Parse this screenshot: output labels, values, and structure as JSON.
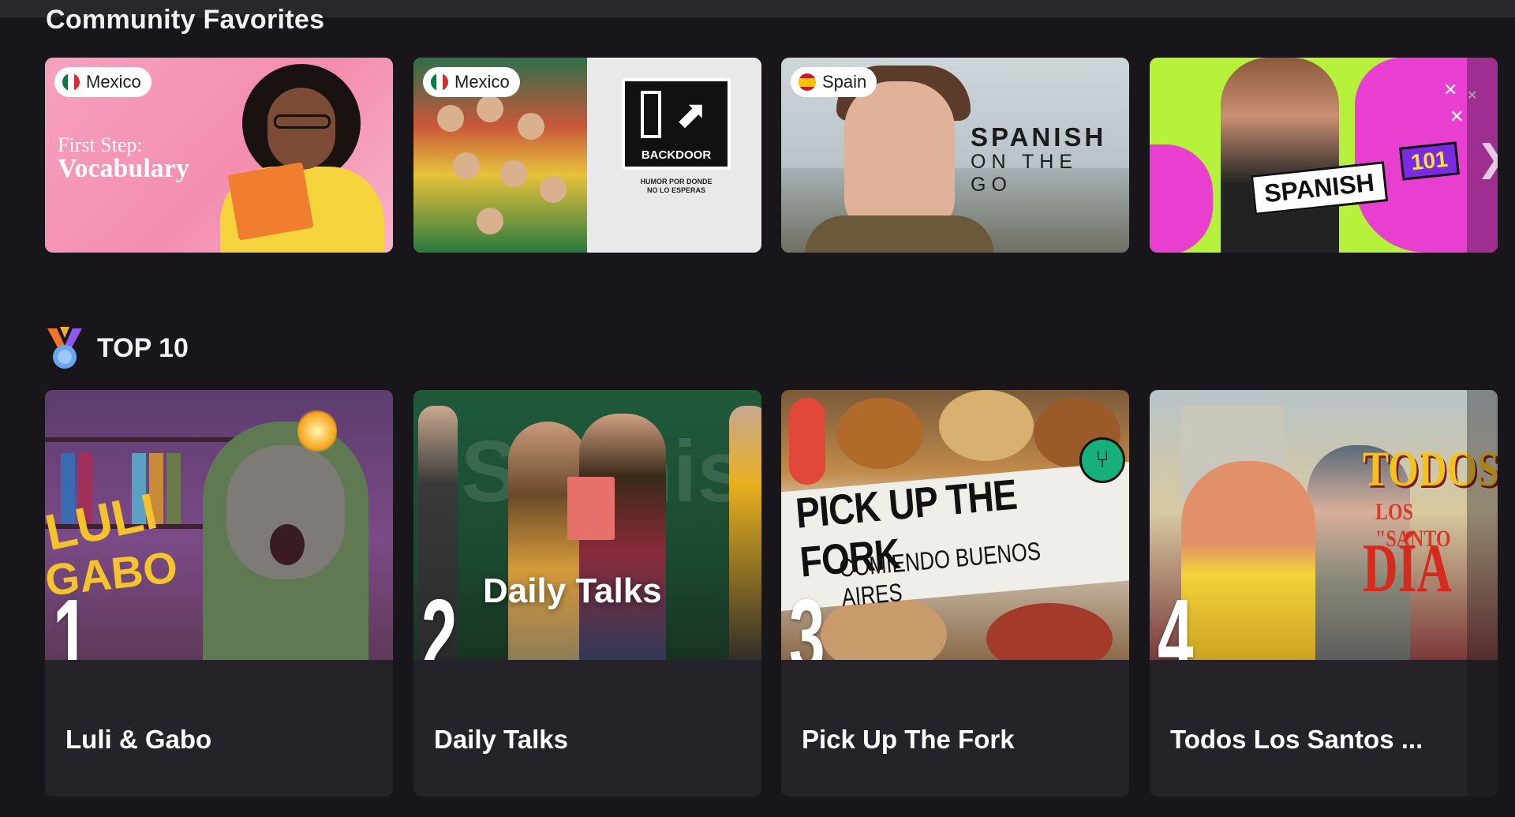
{
  "community_favorites": {
    "title": "Community Favorites",
    "cards": [
      {
        "country": "Mexico",
        "flag": "mexico-flag",
        "art_text": [
          "First Step:",
          "Vocabulary"
        ]
      },
      {
        "country": "Mexico",
        "flag": "mexico-flag",
        "art_text": [
          "BACKDOOR",
          "HUMOR POR DONDE",
          "NO LO ESPERAS"
        ]
      },
      {
        "country": "Spain",
        "flag": "spain-flag",
        "art_text": [
          "SPANISH",
          "ON THE GO"
        ]
      },
      {
        "country": "",
        "flag": "",
        "art_text": [
          "SPANISH",
          "101"
        ]
      }
    ],
    "next_icon": "chevron-right-icon"
  },
  "top10": {
    "title": "TOP 10",
    "icon": "medal-icon",
    "items": [
      {
        "rank": "1",
        "name": "Luli & Gabo",
        "art_text": [
          "LULI",
          "GABO"
        ]
      },
      {
        "rank": "2",
        "name": "Daily Talks",
        "art_text": [
          "Spanish",
          "Daily Talks"
        ]
      },
      {
        "rank": "3",
        "name": "Pick Up The Fork",
        "art_text": [
          "PICK UP THE FORK",
          "COMIENDO BUENOS AIRES"
        ]
      },
      {
        "rank": "4",
        "name": "Todos Los Santos ...",
        "art_text": [
          "TODOS",
          "LOS \"SANTO",
          "DÍA"
        ]
      }
    ]
  },
  "colors": {
    "background": "#18151b",
    "card": "#252229",
    "pill": "#ffffff"
  }
}
